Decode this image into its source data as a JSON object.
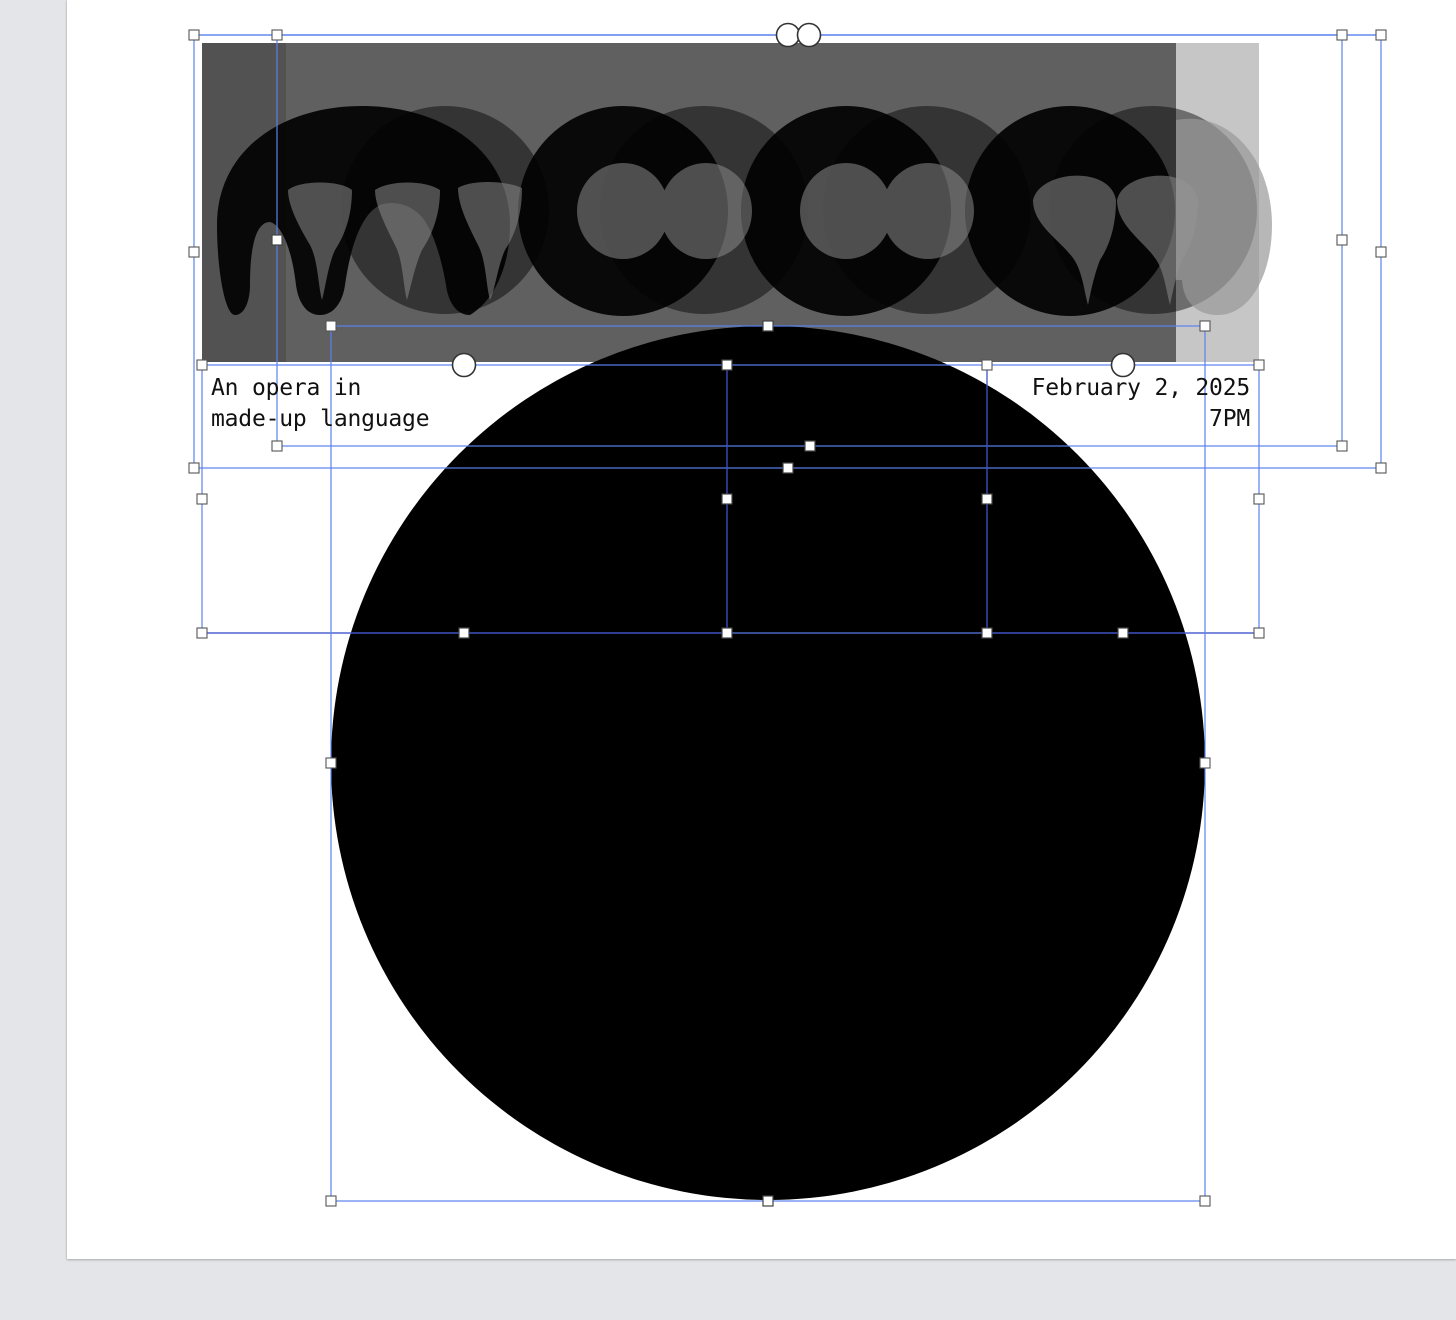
{
  "canvas": {
    "background": "#e4e5e8",
    "artboard_color": "#ffffff",
    "selection_color": "#5a82f0",
    "selection_color_dark": "#3f54c9"
  },
  "banner": {
    "bg_dark": "#606060",
    "bg_darker": "#505050",
    "bg_light": "#c4c4c4",
    "shape_color": "#000000"
  },
  "caption": {
    "left_line1": "An opera in",
    "left_line2": "made-up language",
    "right_line1": "February 2, 2025",
    "right_line2": "7PM"
  },
  "circle": {
    "fill": "#000000"
  }
}
